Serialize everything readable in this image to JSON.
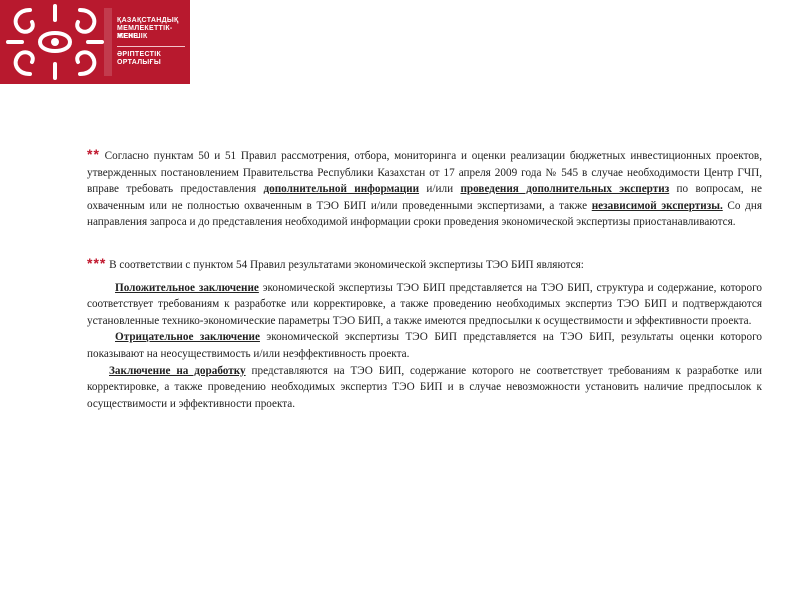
{
  "header": {
    "logo_lines": [
      "ҚАЗАҚСТАНДЫҚ",
      "МЕМЛЕКЕТТІК-ЖЕКЕ",
      "МЕНШІК",
      "ӘРІПТЕСТІК",
      "ОРТАЛЫҒЫ"
    ],
    "brand_color": "#b8192e"
  },
  "paragraphs": {
    "p1": {
      "mark": "**",
      "t1": " Согласно пунктам 50 и 51 Правил рассмотрения, отбора, мониторинга и оценки реализации бюджетных инвестиционных проектов, утвержденных постановлением Правительства Республики Казахстан от 17 апреля 2009 года № 545 в случае необходимости Центр ГЧП, вправе требовать предоставления ",
      "b1": "дополнительной информации",
      "t2": " и/или ",
      "b2": "проведения дополнительных экспертиз",
      "t3": " по вопросам, не охваченным или не полностью охваченным в ТЭО БИП и/или проведенными экспертизами, а также ",
      "b3": "независимой экспертизы.",
      "t4": " Со дня направления запроса и до представления необходимой информации сроки проведения экономической экспертизы приостанавливаются."
    },
    "p2": {
      "mark": "***",
      "t1": " В соответствии с пунктом 54 Правил результатами экономической экспертизы ТЭО БИП являются:"
    },
    "p3": {
      "b1": "Положительное заключение",
      "t1": " экономической экспертизы ТЭО БИП представляется на ТЭО БИП, структура и содержание, которого соответствует требованиям к разработке или корректировке, а также проведению необходимых экспертиз ТЭО БИП и подтверждаются установленные технико-экономические параметры ТЭО БИП, а также имеются предпосылки к осуществимости и эффективности проекта."
    },
    "p4": {
      "b1": "Отрицательное заключение",
      "t1": " экономической экспертизы ТЭО БИП представляется на ТЭО БИП, результаты оценки которого показывают на неосуществимость и/или неэффективность проекта."
    },
    "p5": {
      "b1": "Заключение на доработку",
      "t1": " представляются на ТЭО БИП, содержание которого не соответствует требованиям к разработке или корректировке, а также проведению необходимых экспертиз ТЭО БИП и в случае невозможности установить наличие предпосылок к осуществимости и эффективности проекта."
    }
  }
}
